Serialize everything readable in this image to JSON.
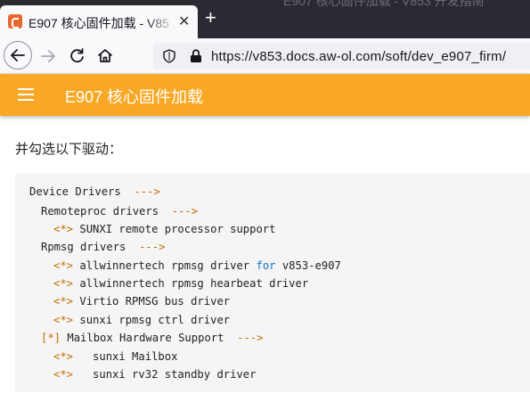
{
  "window": {
    "title_fragment": "E907 核心固件加载 - V853 开发指南"
  },
  "browser": {
    "tab": {
      "title": "E907 核心固件加载 - V85",
      "favicon": "aw-ol-favicon-icon"
    },
    "new_tab_label": "+",
    "url": "https://v853.docs.aw-ol.com/soft/dev_e907_firm/"
  },
  "site": {
    "title": "E907 核心固件加载",
    "header_color": "#f9a825"
  },
  "content": {
    "intro": "并勾选以下驱动：",
    "code_lines": [
      {
        "mark": "",
        "text": "Device Drivers",
        "kw": "",
        "after": "",
        "arrow": "--->"
      },
      {
        "mark": "",
        "text": "Remoteproc drivers",
        "kw": "",
        "after": "",
        "arrow": "--->"
      },
      {
        "mark": "<*>",
        "text": "SUNXI remote processor support",
        "kw": "",
        "after": "",
        "arrow": ""
      },
      {
        "mark": "",
        "text": "Rpmsg drivers",
        "kw": "",
        "after": "",
        "arrow": "--->"
      },
      {
        "mark": "<*>",
        "text": "allwinnertech rpmsg driver",
        "kw": "for",
        "after": "v853-e907",
        "arrow": ""
      },
      {
        "mark": "<*>",
        "text": "allwinnertech rpmsg hearbeat driver",
        "kw": "",
        "after": "",
        "arrow": ""
      },
      {
        "mark": "<*>",
        "text": "Virtio RPMSG bus driver",
        "kw": "",
        "after": "",
        "arrow": ""
      },
      {
        "mark": "<*>",
        "text": "sunxi rpmsg ctrl driver",
        "kw": "",
        "after": "",
        "arrow": ""
      },
      {
        "mark": "[*]",
        "text": "Mailbox Hardware Support",
        "kw": "",
        "after": "",
        "arrow": "--->"
      },
      {
        "mark": "<*>",
        "text": "  sunxi Mailbox",
        "kw": "",
        "after": "",
        "arrow": ""
      },
      {
        "mark": "<*>",
        "text": "  sunxi rv32 standby driver",
        "kw": "",
        "after": "",
        "arrow": ""
      }
    ]
  }
}
